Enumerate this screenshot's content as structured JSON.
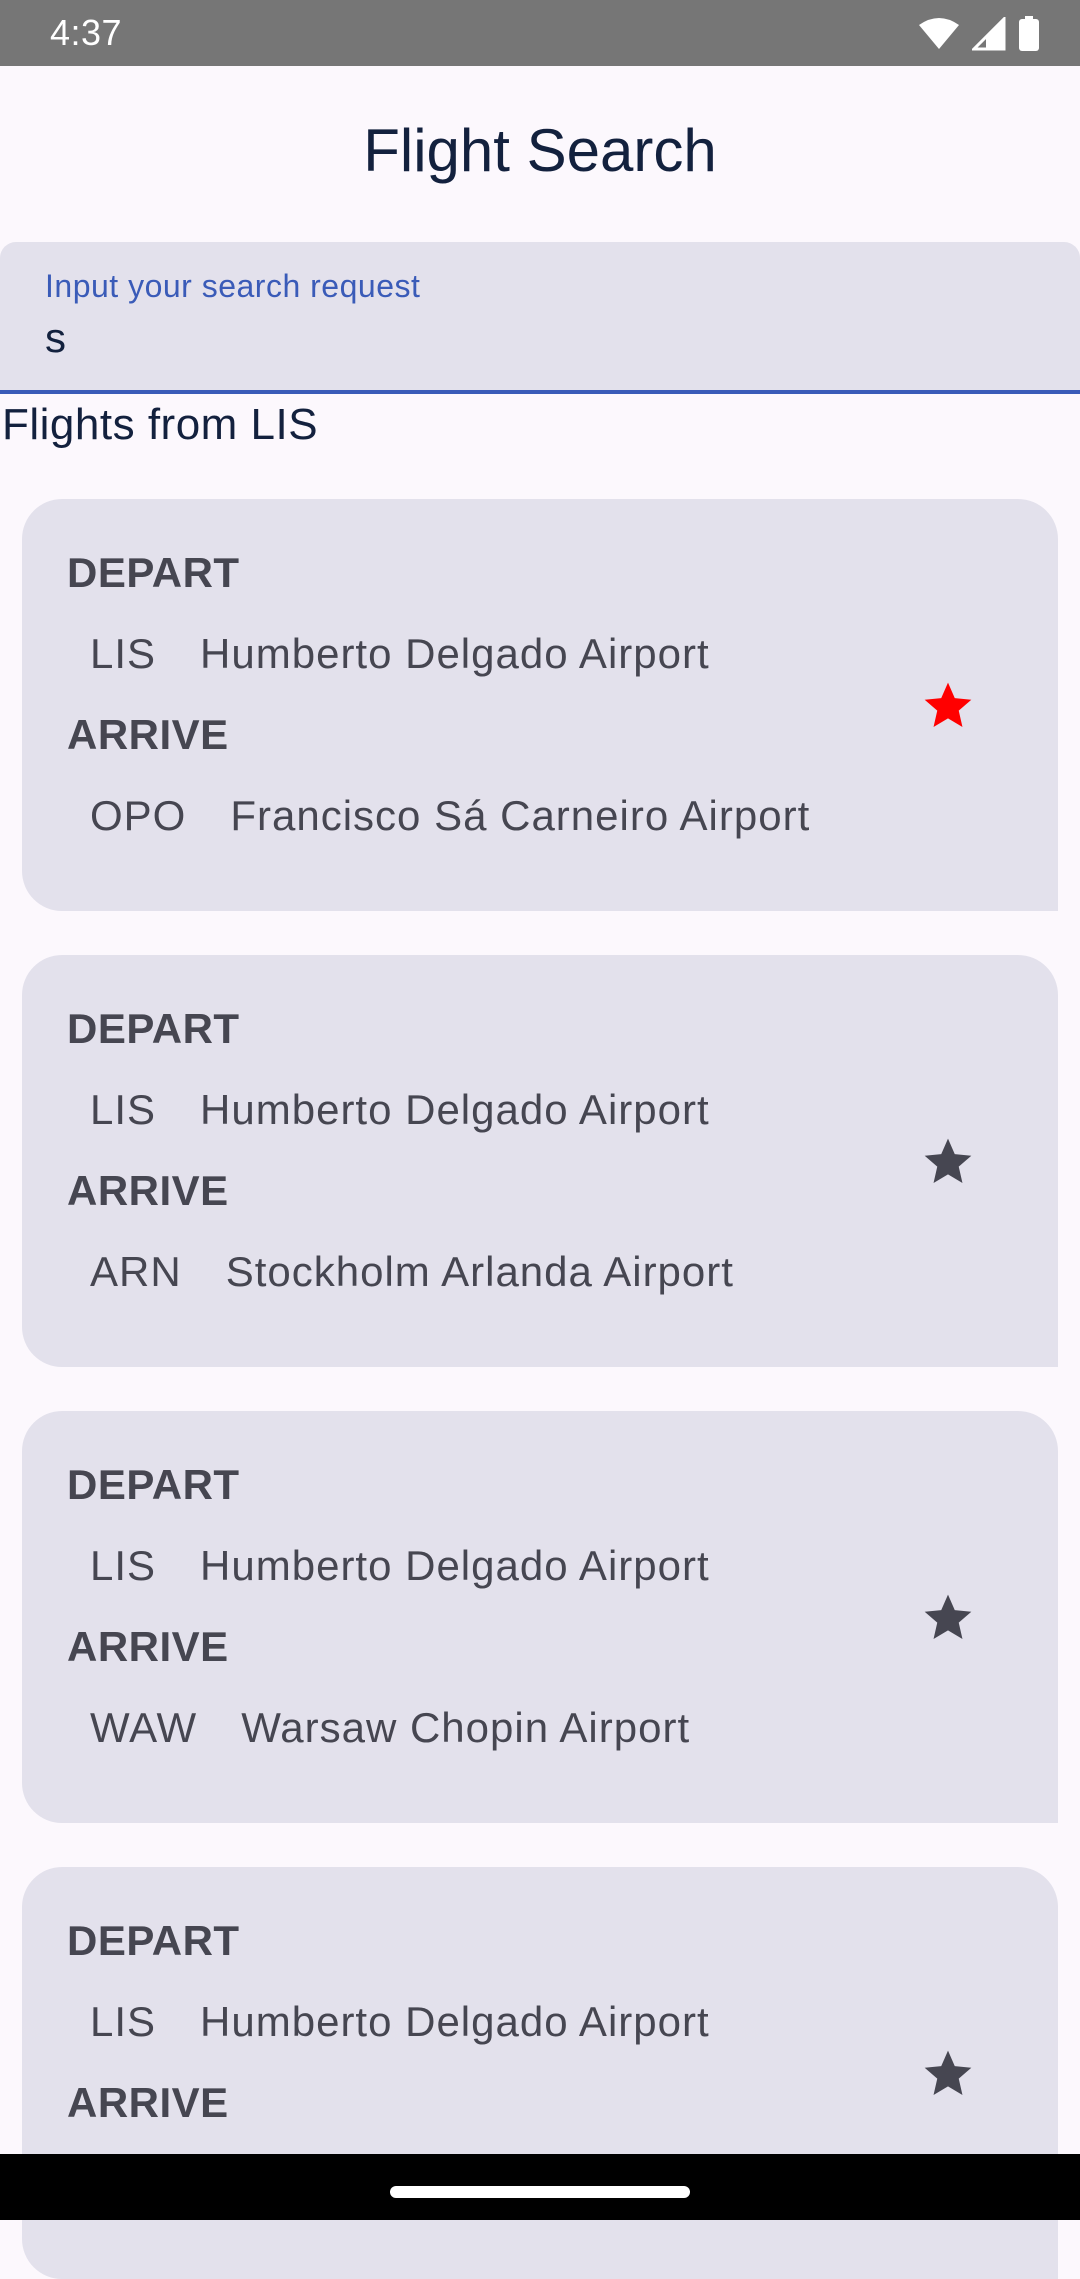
{
  "status_bar": {
    "time": "4:37",
    "icons": [
      "wifi-icon",
      "cell-signal-icon",
      "battery-icon"
    ]
  },
  "app": {
    "title": "Flight Search"
  },
  "search": {
    "label": "Input your search request",
    "value": "s"
  },
  "results": {
    "heading": "Flights from LIS",
    "depart_label": "DEPART",
    "arrive_label": "ARRIVE",
    "flights": [
      {
        "depart_code": "LIS",
        "depart_name": "Humberto Delgado Airport",
        "arrive_code": "OPO",
        "arrive_name": "Francisco Sá Carneiro Airport",
        "favorite": true
      },
      {
        "depart_code": "LIS",
        "depart_name": "Humberto Delgado Airport",
        "arrive_code": "ARN",
        "arrive_name": "Stockholm Arlanda Airport",
        "favorite": false
      },
      {
        "depart_code": "LIS",
        "depart_name": "Humberto Delgado Airport",
        "arrive_code": "WAW",
        "arrive_name": "Warsaw Chopin Airport",
        "favorite": false
      },
      {
        "depart_code": "LIS",
        "depart_name": "Humberto Delgado Airport",
        "arrive_code": "",
        "arrive_name": "",
        "favorite": false
      }
    ]
  },
  "colors": {
    "favorite_active": "#ff0000",
    "favorite_inactive": "#464651",
    "accent": "#3a5bb8",
    "card_background": "#e3e1ec"
  }
}
